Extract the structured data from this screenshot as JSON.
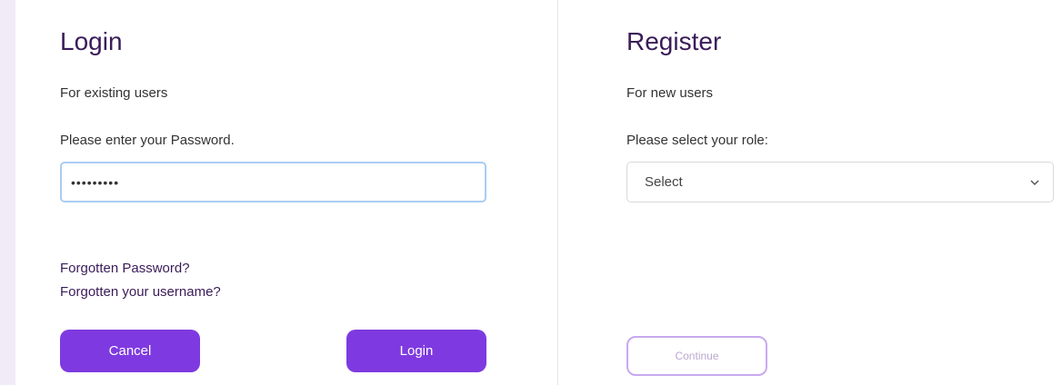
{
  "login": {
    "title": "Login",
    "subtitle": "For existing users",
    "password_prompt": "Please enter your Password.",
    "password_value": "•••••••••",
    "forgot_password": "Forgotten Password?",
    "forgot_username": "Forgotten your username?",
    "cancel_label": "Cancel",
    "login_label": "Login"
  },
  "register": {
    "title": "Register",
    "subtitle": "For new users",
    "role_prompt": "Please select your role:",
    "role_selected": "Select",
    "continue_label": "Continue"
  },
  "colors": {
    "accent": "#7e3ae0",
    "title": "#3a1c59",
    "page_background": "#f1eaf7",
    "focus_border": "#a9cdef"
  },
  "icons": {
    "select_chevron": "chevron-down-icon"
  }
}
